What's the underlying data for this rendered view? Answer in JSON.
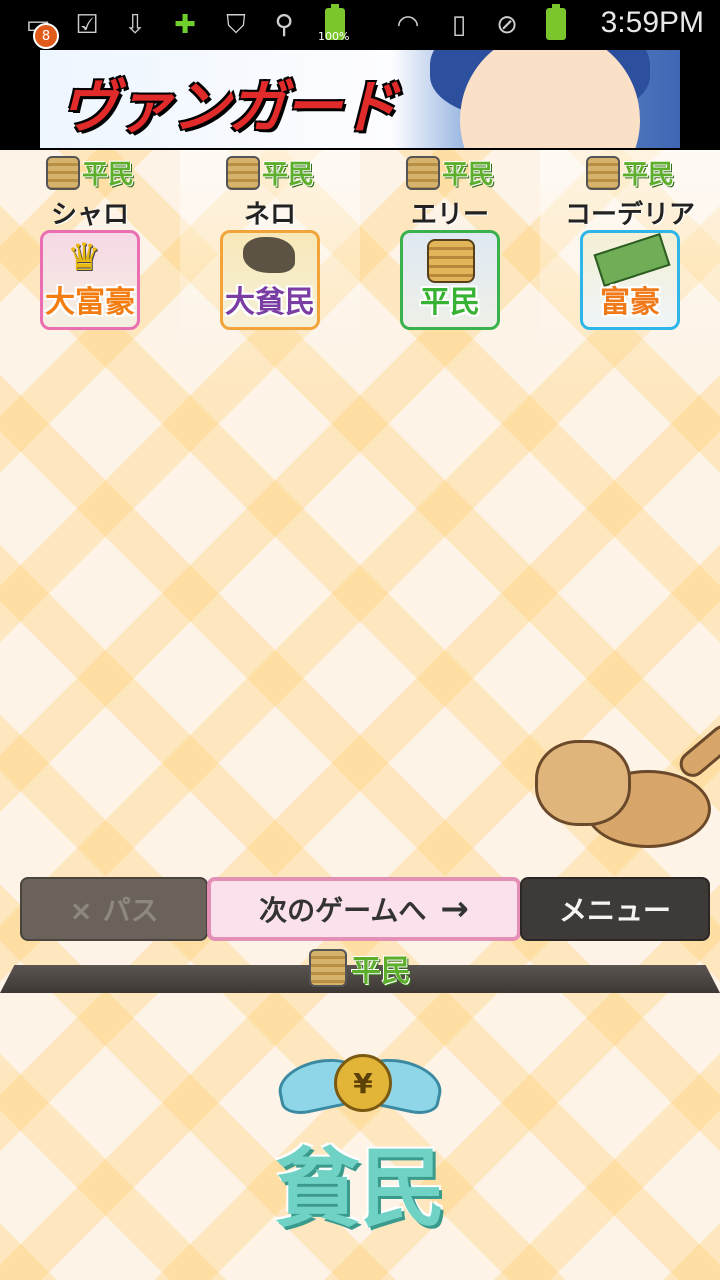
{
  "status_bar": {
    "notification_count": "8",
    "battery_text": "100%",
    "time": "3:59PM"
  },
  "ad": {
    "text": "ヴァンガード"
  },
  "players": [
    {
      "name": "シャロ",
      "small_rank": "平民",
      "badge": "大富豪"
    },
    {
      "name": "ネロ",
      "small_rank": "平民",
      "badge": "大貧民"
    },
    {
      "name": "エリー",
      "small_rank": "平民",
      "badge": "平民"
    },
    {
      "name": "コーデリア",
      "small_rank": "平民",
      "badge": "富豪"
    }
  ],
  "actions": {
    "pass_label": "× パス",
    "next_label": "次のゲームへ",
    "next_arrow": "→",
    "menu_label": "メニュー"
  },
  "self": {
    "small_rank": "平民",
    "rank_title": "貧民",
    "coin_symbol": "¥"
  }
}
